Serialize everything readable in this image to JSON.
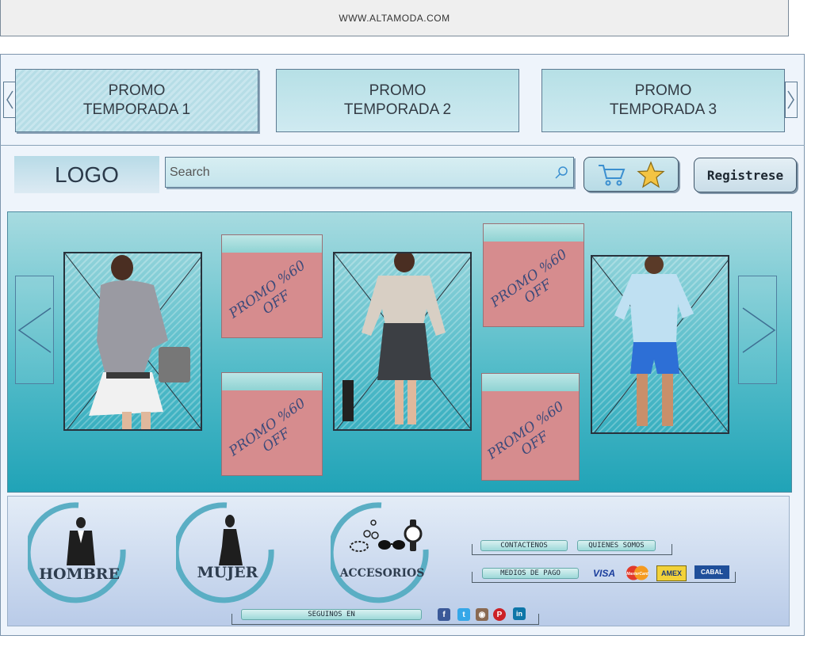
{
  "url": "WWW.ALTAMODA.COM",
  "promos": [
    {
      "line1": "PROMO",
      "line2": "TEMPORADA 1"
    },
    {
      "line1": "PROMO",
      "line2": "TEMPORADA 2"
    },
    {
      "line1": "PROMO",
      "line2": "TEMPORADA 3"
    }
  ],
  "header": {
    "logo": "LOGO",
    "search_placeholder": "Search",
    "register_label": "Registrese"
  },
  "carousel": {
    "badge_line1": "PROMO %60",
    "badge_line2": "OFF"
  },
  "categories": [
    {
      "label": "HOMBRE"
    },
    {
      "label": "MUJER"
    },
    {
      "label": "ACCESORIOS"
    }
  ],
  "footer": {
    "contact": "CONTACTENOS",
    "about": "QUIENES SOMOS",
    "payment": "MEDIOS DE PAGO",
    "follow": "SEGUINOS EN",
    "cards": [
      "VISA",
      "MasterCard",
      "AMEX",
      "CABAL"
    ]
  },
  "colors": {
    "accent": "#20a3b7",
    "promo_badge": "#d68c8e",
    "frame_border": "#7d95ad"
  }
}
